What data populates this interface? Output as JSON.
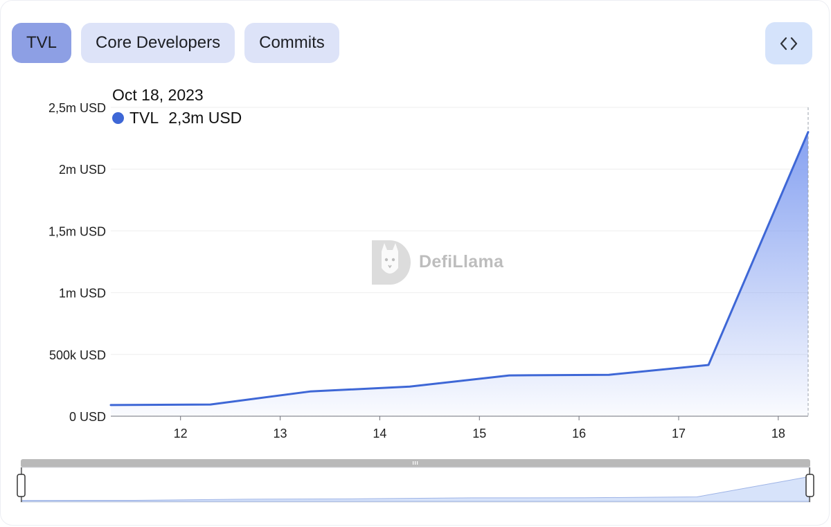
{
  "tabs": [
    {
      "label": "TVL",
      "active": true
    },
    {
      "label": "Core Developers",
      "active": false
    },
    {
      "label": "Commits",
      "active": false
    }
  ],
  "embed_icon": "code-brackets-icon",
  "tooltip": {
    "date": "Oct 18, 2023",
    "series": "TVL",
    "value": "2,3m USD",
    "color": "#3e67d6"
  },
  "watermark": {
    "text": "DefiLlama",
    "icon": "llama-logo-icon"
  },
  "chart_data": {
    "type": "area",
    "x": [
      11.3,
      12.3,
      13.3,
      14.3,
      15.3,
      16.3,
      17.3,
      18.3
    ],
    "series": [
      {
        "name": "TVL",
        "values": [
          90000,
          95000,
          200000,
          240000,
          330000,
          335000,
          415000,
          2300000
        ]
      }
    ],
    "xticks": [
      12,
      13,
      14,
      15,
      16,
      17,
      18
    ],
    "xtick_labels": [
      "12",
      "13",
      "14",
      "15",
      "16",
      "17",
      "18"
    ],
    "xlim": [
      11.3,
      18.3
    ],
    "ylim": [
      0,
      2500000
    ],
    "yticks": [
      0,
      500000,
      1000000,
      1500000,
      2000000,
      2500000
    ],
    "ytick_labels": [
      "0 USD",
      "500k USD",
      "1m USD",
      "1,5m USD",
      "2m USD",
      "2,5m USD"
    ],
    "grid": true,
    "line_color": "#3e67d6",
    "fill_color": "#7f9cf0"
  },
  "zoom_slider": {
    "start": 0,
    "end": 1
  }
}
